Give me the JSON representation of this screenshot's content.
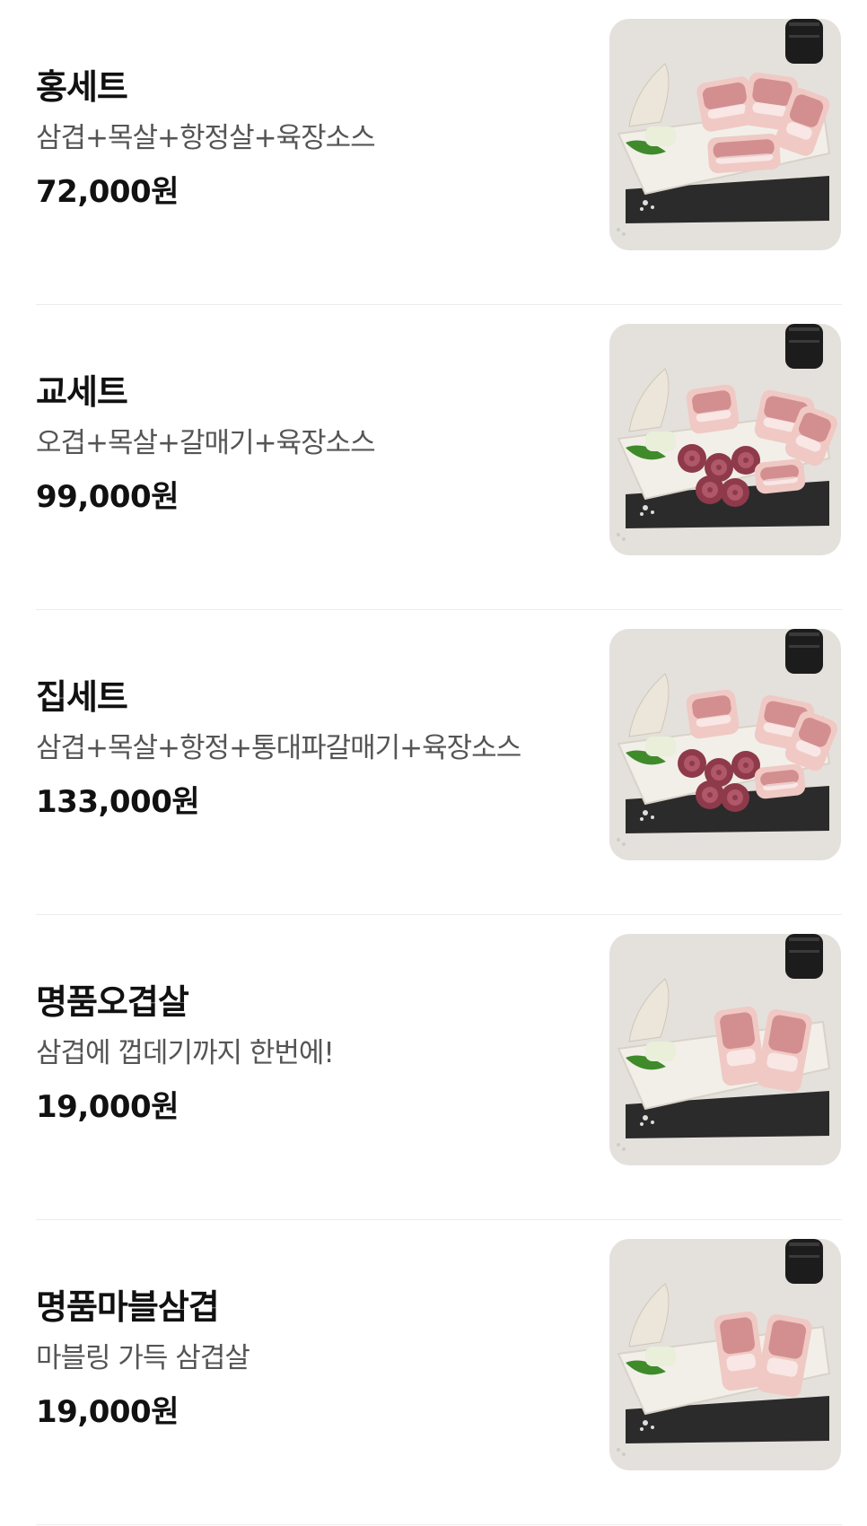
{
  "menu": {
    "items": [
      {
        "name": "홍세트",
        "description": "삼겹+목살+항정살+육장소스",
        "price": "72,000원",
        "photo": {
          "variant": "set-small"
        }
      },
      {
        "name": "교세트",
        "description": "오겹+목살+갈매기+육장소스",
        "price": "99,000원",
        "photo": {
          "variant": "set-large"
        }
      },
      {
        "name": "집세트",
        "description": "삼겹+목살+항정+통대파갈매기+육장소스",
        "price": "133,000원",
        "photo": {
          "variant": "set-large"
        }
      },
      {
        "name": "명품오겹살",
        "description": "삼겹에 껍데기까지 한번에!",
        "price": "19,000원",
        "photo": {
          "variant": "single-cut"
        }
      },
      {
        "name": "명품마블삼겹",
        "description": "마블링 가득 삼겹살",
        "price": "19,000원",
        "photo": {
          "variant": "single-cut"
        }
      }
    ]
  },
  "colors": {
    "photo_background": "#e4e1dc",
    "slate": "#2b2b2b",
    "plate": "#f2efe9",
    "meat_light": "#f0c9c4",
    "meat_dark": "#c97b7f",
    "galmaegi": "#8e3a4a",
    "pepper": "#3f8a2a"
  }
}
